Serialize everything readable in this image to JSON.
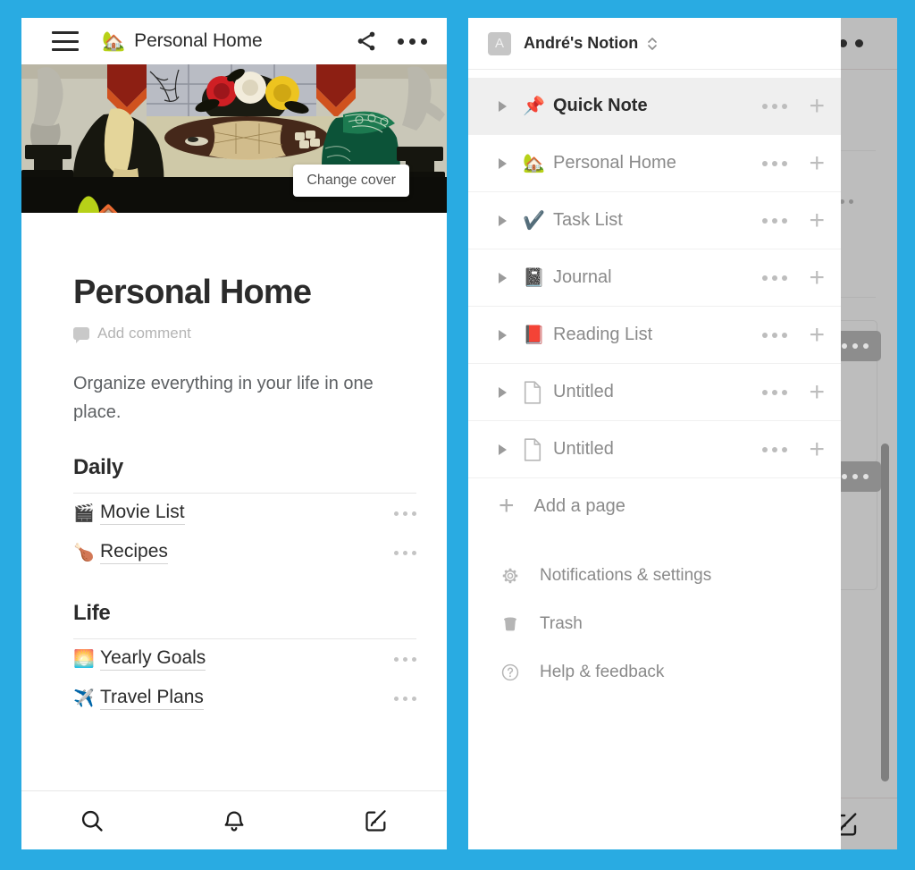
{
  "theme": {
    "background_blue": "#29abe2",
    "panel_white": "#ffffff",
    "active_row_gray": "#efefef",
    "muted_text": "#8a8a8a",
    "dark_text": "#2b2b2b"
  },
  "left_panel": {
    "topbar": {
      "menu_icon": "hamburger-menu-icon",
      "page_emoji": "🏡",
      "title": "Personal Home",
      "share_icon": "share-icon",
      "more_icon": "more-horizontal-icon"
    },
    "cover": {
      "change_cover_label": "Change cover",
      "alt": "painting of an interior with roses on a table"
    },
    "page": {
      "emoji": "🏡",
      "title": "Personal Home",
      "add_comment_label": "Add comment",
      "intro": "Organize everything in your life in one place."
    },
    "sections": [
      {
        "heading": "Daily",
        "links": [
          {
            "emoji": "🎬",
            "label": "Movie List",
            "more_icon": "more-horizontal-icon"
          },
          {
            "emoji": "🍗",
            "label": "Recipes",
            "more_icon": "more-horizontal-icon"
          }
        ]
      },
      {
        "heading": "Life",
        "links": [
          {
            "emoji": "🌅",
            "label": "Yearly Goals",
            "more_icon": "more-horizontal-icon"
          },
          {
            "emoji": "✈️",
            "label": "Travel Plans",
            "more_icon": "more-horizontal-icon"
          }
        ]
      }
    ],
    "tabbar": [
      {
        "icon": "search-icon",
        "label": "Search"
      },
      {
        "icon": "bell-icon",
        "label": "Notifications"
      },
      {
        "icon": "compose-icon",
        "label": "New page"
      }
    ]
  },
  "right_panel": {
    "workspace": {
      "avatar_initial": "A",
      "name": "André's Notion",
      "switcher_icon": "chevron-up-down-icon"
    },
    "pages": [
      {
        "emoji": "📌",
        "icon": "pin-emoji",
        "label": "Quick Note",
        "active": true
      },
      {
        "emoji": "🏡",
        "icon": "house-emoji",
        "label": "Personal Home",
        "active": false
      },
      {
        "emoji": "✔️",
        "icon": "check-emoji",
        "label": "Task List",
        "active": false
      },
      {
        "emoji": "📓",
        "icon": "notebook-emoji",
        "label": "Journal",
        "active": false
      },
      {
        "emoji": "📕",
        "icon": "closed-book-emoji",
        "label": "Reading List",
        "active": false
      },
      {
        "emoji": "",
        "icon": "page-icon",
        "label": "Untitled",
        "active": false
      },
      {
        "emoji": "",
        "icon": "page-icon",
        "label": "Untitled",
        "active": false
      }
    ],
    "row_actions": {
      "more_icon": "more-horizontal-icon",
      "add_icon": "plus-icon"
    },
    "add_page_label": "Add a page",
    "utilities": [
      {
        "icon": "gear-icon",
        "label": "Notifications & settings"
      },
      {
        "icon": "trash-icon",
        "label": "Trash"
      },
      {
        "icon": "help-circle-icon",
        "label": "Help & feedback"
      }
    ],
    "background": {
      "more_icon": "more-horizontal-icon",
      "compose_icon": "compose-icon",
      "scrollbar": "vertical-scrollbar"
    }
  }
}
